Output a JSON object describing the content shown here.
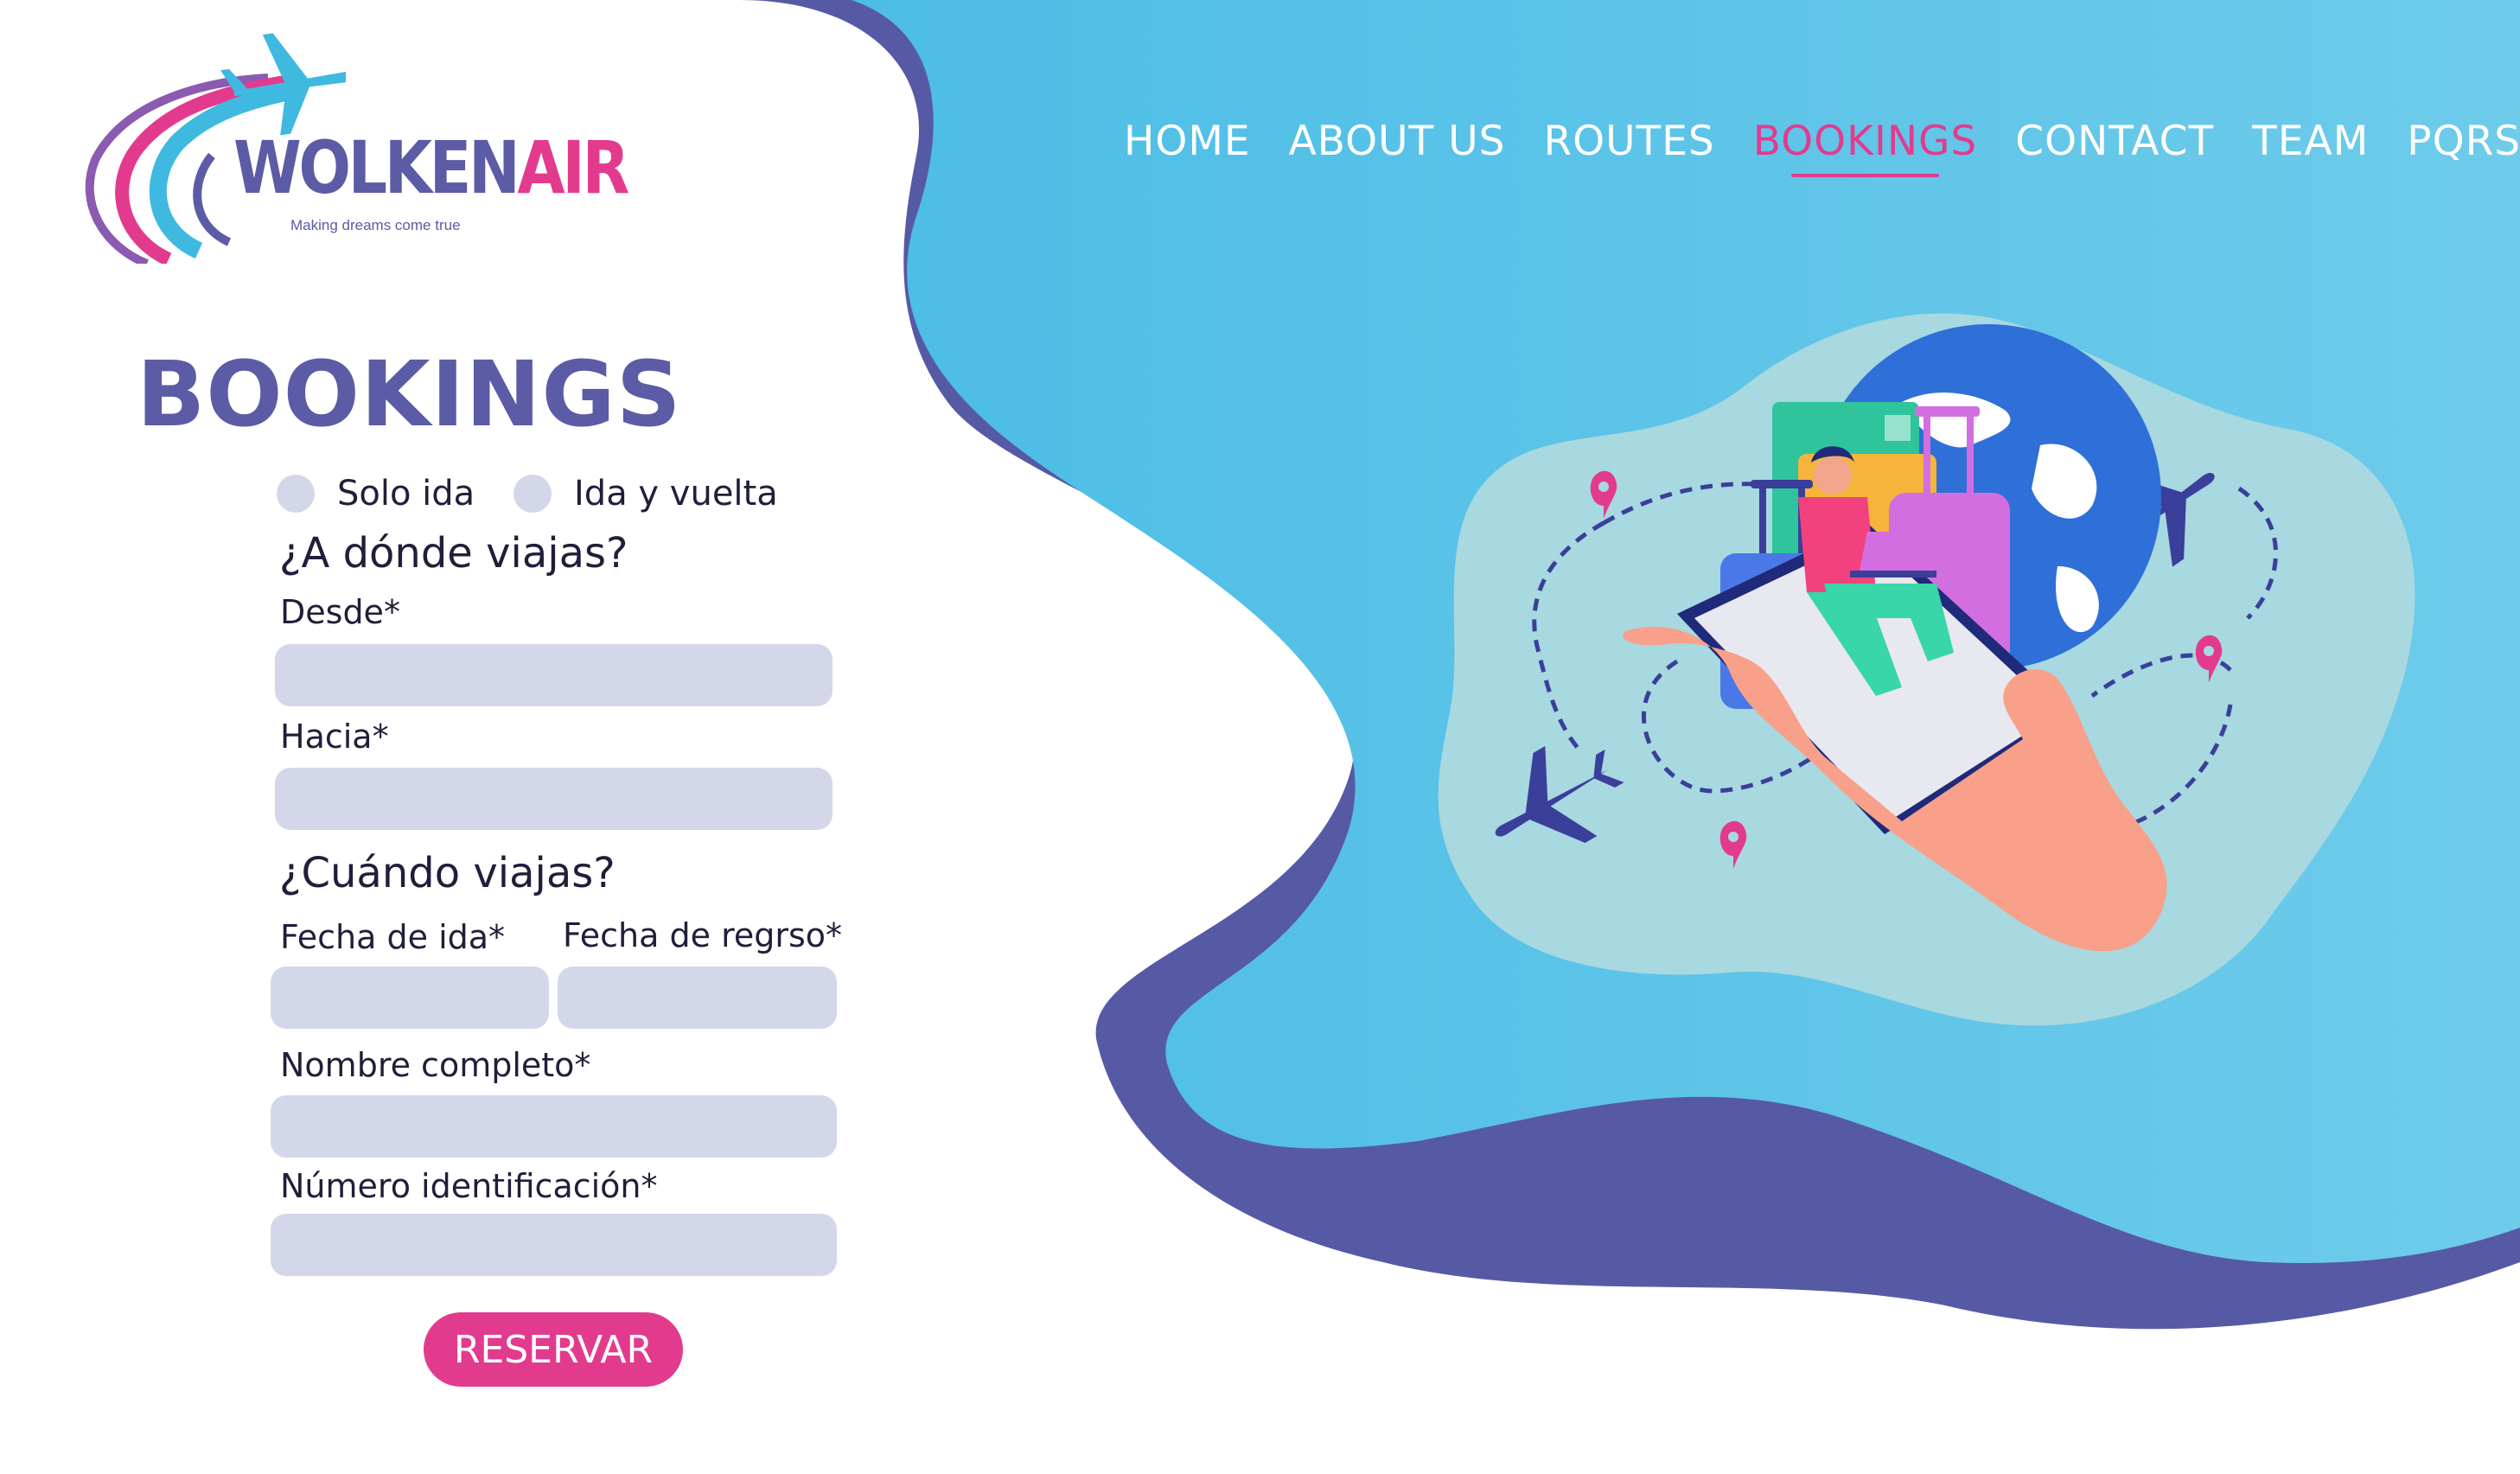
{
  "brand": {
    "name_part1": "WOLKEN",
    "name_part2": "AIR",
    "tagline": "Making dreams come true",
    "logo_icon": "airplane-swoosh-logo"
  },
  "nav": {
    "items": [
      {
        "label": "HOME",
        "active": false
      },
      {
        "label": "ABOUT US",
        "active": false
      },
      {
        "label": "ROUTES",
        "active": false
      },
      {
        "label": "BOOKINGS",
        "active": true
      },
      {
        "label": "CONTACT",
        "active": false
      },
      {
        "label": "TEAM",
        "active": false
      },
      {
        "label": "PQRS",
        "active": false
      }
    ]
  },
  "page": {
    "title": "BOOKINGS"
  },
  "form": {
    "trip_type": {
      "one_way": "Solo ida",
      "round_trip": "Ida y vuelta"
    },
    "where_heading": "¿A dónde viajas?",
    "from_label": "Desde*",
    "from_value": "",
    "to_label": "Hacia*",
    "to_value": "",
    "when_heading": "¿Cuándo viajas?",
    "departure_label": "Fecha de ida*",
    "departure_value": "",
    "return_label": "Fecha de regrso*",
    "return_value": "",
    "name_label": "Nombre completo*",
    "name_value": "",
    "id_label": "Número identificación*",
    "id_value": "",
    "submit_label": "RESERVAR"
  },
  "colors": {
    "brand_purple": "#5b5ba6",
    "brand_pink": "#e23b8e",
    "sky_blue": "#4fbfe6",
    "field_bg": "#d4d6ea",
    "blob_light": "#a8d8e0"
  },
  "illustration": {
    "icons": [
      "hand-holding-phone",
      "traveler-with-laptop",
      "suitcase-icon",
      "globe-icon",
      "airplane-icon",
      "map-pin-icon",
      "dashed-route"
    ]
  }
}
